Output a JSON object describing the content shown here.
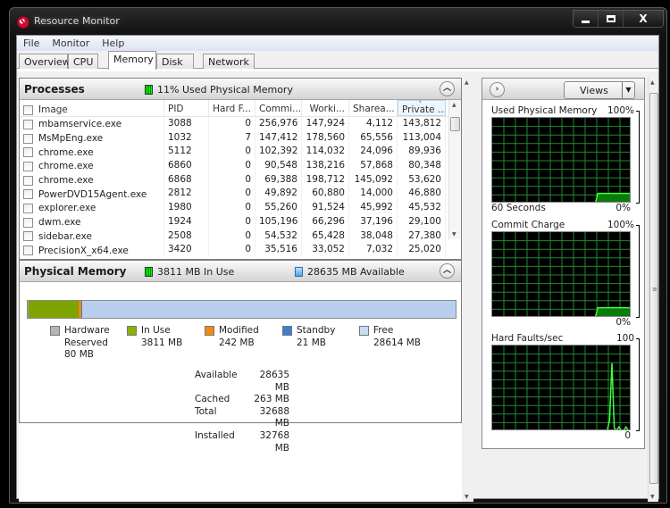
{
  "window": {
    "title": "Resource Monitor",
    "controls": {
      "minimize": "minimize",
      "maximize": "maximize",
      "close": "X"
    }
  },
  "menu": [
    "File",
    "Monitor",
    "Help"
  ],
  "tabs": [
    {
      "label": "Overview",
      "active": false
    },
    {
      "label": "CPU",
      "active": false
    },
    {
      "label": "Memory",
      "active": true
    },
    {
      "label": "Disk",
      "active": false
    },
    {
      "label": "Network",
      "active": false
    }
  ],
  "processes": {
    "title": "Processes",
    "summary": "11% Used Physical Memory",
    "columns": [
      "Image",
      "PID",
      "Hard F...",
      "Commi...",
      "Worki...",
      "Sharea...",
      "Private ..."
    ],
    "sorted_column": "Private ...",
    "rows": [
      {
        "image": "mbamservice.exe",
        "pid": "3088",
        "hard_faults": "0",
        "commit": "256,976",
        "working": "147,924",
        "shareable": "4,112",
        "private": "143,812"
      },
      {
        "image": "MsMpEng.exe",
        "pid": "1032",
        "hard_faults": "7",
        "commit": "147,412",
        "working": "178,560",
        "shareable": "65,556",
        "private": "113,004"
      },
      {
        "image": "chrome.exe",
        "pid": "5112",
        "hard_faults": "0",
        "commit": "102,392",
        "working": "114,032",
        "shareable": "24,096",
        "private": "89,936"
      },
      {
        "image": "chrome.exe",
        "pid": "6860",
        "hard_faults": "0",
        "commit": "90,548",
        "working": "138,216",
        "shareable": "57,868",
        "private": "80,348"
      },
      {
        "image": "chrome.exe",
        "pid": "6868",
        "hard_faults": "0",
        "commit": "69,388",
        "working": "198,712",
        "shareable": "145,092",
        "private": "53,620"
      },
      {
        "image": "PowerDVD15Agent.exe",
        "pid": "2812",
        "hard_faults": "0",
        "commit": "49,892",
        "working": "60,880",
        "shareable": "14,000",
        "private": "46,880"
      },
      {
        "image": "explorer.exe",
        "pid": "1980",
        "hard_faults": "0",
        "commit": "55,260",
        "working": "91,524",
        "shareable": "45,992",
        "private": "45,532"
      },
      {
        "image": "dwm.exe",
        "pid": "1924",
        "hard_faults": "0",
        "commit": "105,196",
        "working": "66,296",
        "shareable": "37,196",
        "private": "29,100"
      },
      {
        "image": "sidebar.exe",
        "pid": "2508",
        "hard_faults": "0",
        "commit": "54,532",
        "working": "65,428",
        "shareable": "38,048",
        "private": "27,380"
      },
      {
        "image": "PrecisionX_x64.exe",
        "pid": "3420",
        "hard_faults": "0",
        "commit": "35,516",
        "working": "33,052",
        "shareable": "7,032",
        "private": "25,020"
      }
    ]
  },
  "physical_memory": {
    "title": "Physical Memory",
    "in_use_summary": "3811 MB In Use",
    "available_summary": "28635 MB Available",
    "bar_segments": [
      {
        "name": "hardware-reserved",
        "mb": 80,
        "color": "#a0a0a0"
      },
      {
        "name": "in-use",
        "mb": 3811,
        "color": "#7fa300"
      },
      {
        "name": "modified",
        "mb": 242,
        "color": "#f0870f"
      },
      {
        "name": "standby",
        "mb": 21,
        "color": "#3f7fcf"
      },
      {
        "name": "free",
        "mb": 28614,
        "color": "#b8d0ee"
      }
    ],
    "legend": [
      {
        "label": "Hardware",
        "label2": "Reserved",
        "value": "80 MB",
        "color": "#b4b4b4"
      },
      {
        "label": "In Use",
        "value": "3811 MB",
        "color": "#8cb100"
      },
      {
        "label": "Modified",
        "value": "242 MB",
        "color": "#f08a10"
      },
      {
        "label": "Standby",
        "value": "21 MB",
        "color": "#3f7fcf"
      },
      {
        "label": "Free",
        "value": "28614 MB",
        "color": "#c7dcf5"
      }
    ],
    "stats": [
      {
        "label": "Available",
        "value": "28635 MB"
      },
      {
        "label": "Cached",
        "value": "263 MB"
      },
      {
        "label": "Total",
        "value": "32688 MB"
      },
      {
        "label": "Installed",
        "value": "32768 MB"
      }
    ]
  },
  "side_panel": {
    "views_label": "Views",
    "graphs": [
      {
        "title": "Used Physical Memory",
        "max": "100%",
        "min": "0%",
        "footer_left": "60 Seconds",
        "series": [
          0,
          0,
          0,
          0,
          0,
          0,
          0,
          0,
          0,
          0,
          0,
          0,
          0,
          0,
          0,
          0,
          0,
          0,
          0,
          0,
          0,
          0,
          0,
          0,
          0,
          0,
          0,
          0,
          0,
          0,
          0,
          0,
          0,
          0,
          0,
          0,
          0,
          0,
          0,
          0,
          0,
          0,
          0,
          0,
          0,
          11,
          11,
          11,
          11,
          11,
          11,
          11,
          11,
          11,
          11,
          11,
          11,
          11,
          11,
          11
        ]
      },
      {
        "title": "Commit Charge",
        "max": "100%",
        "min": "0%",
        "footer_left": "",
        "series": [
          0,
          0,
          0,
          0,
          0,
          0,
          0,
          0,
          0,
          0,
          0,
          0,
          0,
          0,
          0,
          0,
          0,
          0,
          0,
          0,
          0,
          0,
          0,
          0,
          0,
          0,
          0,
          0,
          0,
          0,
          0,
          0,
          0,
          0,
          0,
          0,
          0,
          0,
          0,
          0,
          0,
          0,
          0,
          0,
          0,
          11,
          11,
          11,
          11,
          11,
          11,
          11,
          11,
          11,
          11,
          11,
          11,
          11,
          11,
          11
        ]
      },
      {
        "title": "Hard Faults/sec",
        "max": "100",
        "min": "0",
        "footer_left": "",
        "series": [
          0,
          0,
          0,
          0,
          0,
          0,
          0,
          0,
          0,
          0,
          0,
          0,
          0,
          0,
          0,
          0,
          0,
          0,
          0,
          0,
          0,
          0,
          0,
          0,
          0,
          0,
          0,
          0,
          0,
          0,
          0,
          0,
          0,
          0,
          0,
          0,
          0,
          0,
          0,
          0,
          0,
          0,
          0,
          0,
          0,
          0,
          0,
          0,
          0,
          0,
          12,
          80,
          3,
          0,
          4,
          0,
          0,
          4,
          0,
          0
        ]
      }
    ]
  },
  "colors": {
    "graph_line": "#3dff3d",
    "graph_grid": "#1f8a2f",
    "graph_fill": "#0a7a0a"
  }
}
